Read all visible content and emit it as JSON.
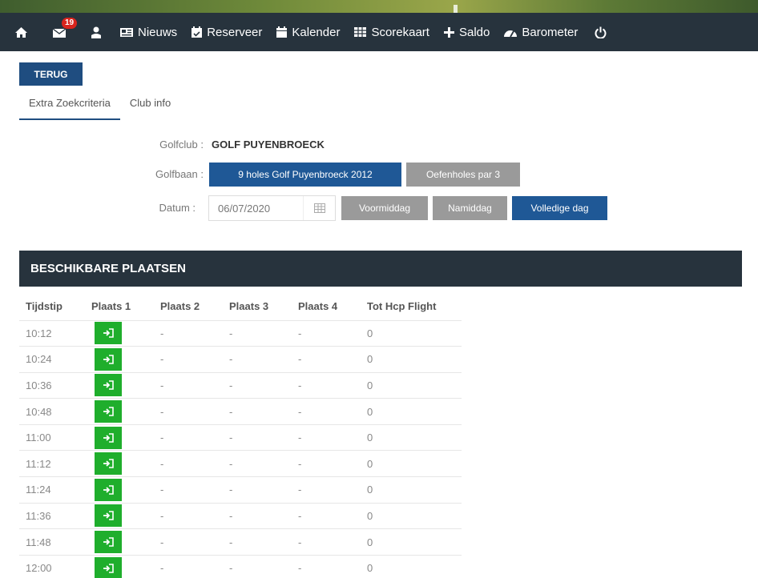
{
  "nav": {
    "home_icon": "home-icon",
    "messages_icon": "envelope-icon",
    "messages_badge": "19",
    "profile_icon": "user-icon",
    "items": [
      {
        "icon": "newspaper-icon",
        "label": "Nieuws"
      },
      {
        "icon": "calendar-check-icon",
        "label": "Reserveer"
      },
      {
        "icon": "calendar-icon",
        "label": "Kalender"
      },
      {
        "icon": "table-icon",
        "label": "Scorekaart"
      },
      {
        "icon": "plus-icon",
        "label": "Saldo"
      },
      {
        "icon": "dashboard-icon",
        "label": "Barometer"
      }
    ],
    "power_icon": "power-icon"
  },
  "back_label": "TERUG",
  "tabs": [
    {
      "label": "Extra Zoekcriteria",
      "active": true
    },
    {
      "label": "Club info",
      "active": false
    }
  ],
  "form": {
    "club_label": "Golfclub :",
    "club_value": "GOLF PUYENBROECK",
    "course_label": "Golfbaan :",
    "course_options": [
      {
        "label": "9 holes Golf Puyenbroeck 2012",
        "selected": true
      },
      {
        "label": "Oefenholes par 3",
        "selected": false
      }
    ],
    "date_label": "Datum :",
    "date_value": "06/07/2020",
    "period_options": [
      {
        "label": "Voormiddag",
        "selected": false
      },
      {
        "label": "Namiddag",
        "selected": false
      },
      {
        "label": "Volledige dag",
        "selected": true
      }
    ]
  },
  "slots": {
    "title": "BESCHIKBARE PLAATSEN",
    "columns": [
      "Tijdstip",
      "Plaats 1",
      "Plaats 2",
      "Plaats 3",
      "Plaats 4",
      "Tot Hcp Flight"
    ],
    "rows": [
      {
        "time": "10:12",
        "p2": "-",
        "p3": "-",
        "p4": "-",
        "hcp": "0"
      },
      {
        "time": "10:24",
        "p2": "-",
        "p3": "-",
        "p4": "-",
        "hcp": "0"
      },
      {
        "time": "10:36",
        "p2": "-",
        "p3": "-",
        "p4": "-",
        "hcp": "0"
      },
      {
        "time": "10:48",
        "p2": "-",
        "p3": "-",
        "p4": "-",
        "hcp": "0"
      },
      {
        "time": "11:00",
        "p2": "-",
        "p3": "-",
        "p4": "-",
        "hcp": "0"
      },
      {
        "time": "11:12",
        "p2": "-",
        "p3": "-",
        "p4": "-",
        "hcp": "0"
      },
      {
        "time": "11:24",
        "p2": "-",
        "p3": "-",
        "p4": "-",
        "hcp": "0"
      },
      {
        "time": "11:36",
        "p2": "-",
        "p3": "-",
        "p4": "-",
        "hcp": "0"
      },
      {
        "time": "11:48",
        "p2": "-",
        "p3": "-",
        "p4": "-",
        "hcp": "0"
      },
      {
        "time": "12:00",
        "p2": "-",
        "p3": "-",
        "p4": "-",
        "hcp": "0"
      }
    ]
  },
  "colors": {
    "navbar": "#27333d",
    "primary": "#1f5896",
    "secondary": "#9a9a9a",
    "book": "#1fae2c",
    "badge": "#d9241d"
  }
}
